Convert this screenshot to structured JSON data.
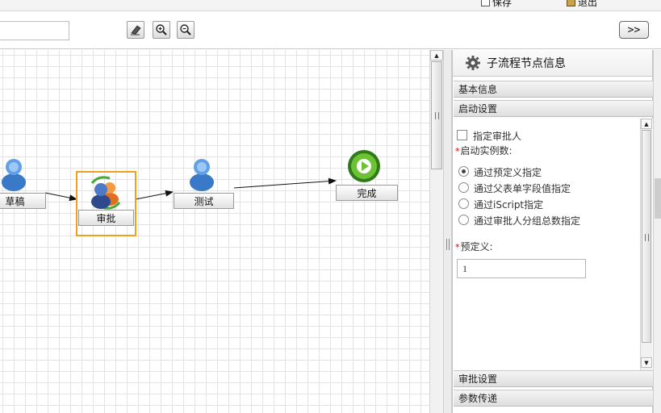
{
  "topbar": {
    "save_label": "保存",
    "exit_label": "退出"
  },
  "toolbar": {
    "name_value": "",
    "tools": [
      {
        "icon": "eraser-icon"
      },
      {
        "icon": "zoom-in-icon"
      },
      {
        "icon": "zoom-out-icon"
      }
    ],
    "expand_label": ">>"
  },
  "canvas": {
    "nodes": [
      {
        "id": "draft",
        "label": "草稿",
        "icon": "user-icon"
      },
      {
        "id": "approve",
        "label": "审批",
        "icon": "user-group-cycle-icon",
        "selected": true
      },
      {
        "id": "test",
        "label": "测试",
        "icon": "user-icon"
      },
      {
        "id": "finish",
        "label": "完成",
        "icon": "end-circle-icon"
      }
    ],
    "selection_color": "#f0a020"
  },
  "panel": {
    "title": "子流程节点信息",
    "sections": {
      "basic": "基本信息",
      "startup": "启动设置",
      "approval": "审批设置",
      "params": "参数传递"
    },
    "startup": {
      "specify_approver_label": "指定审批人",
      "specify_approver_checked": false,
      "instance_count_label": "启动实例数:",
      "options": [
        {
          "label": "通过预定义指定",
          "selected": true
        },
        {
          "label": "通过父表单字段值指定",
          "selected": false
        },
        {
          "label": "通过iScript指定",
          "selected": false
        },
        {
          "label": "通过审批人分组总数指定",
          "selected": false
        }
      ],
      "predefined_label": "预定义:",
      "predefined_value": "1"
    },
    "required_mark": "*",
    "required_color": "#d40000"
  }
}
